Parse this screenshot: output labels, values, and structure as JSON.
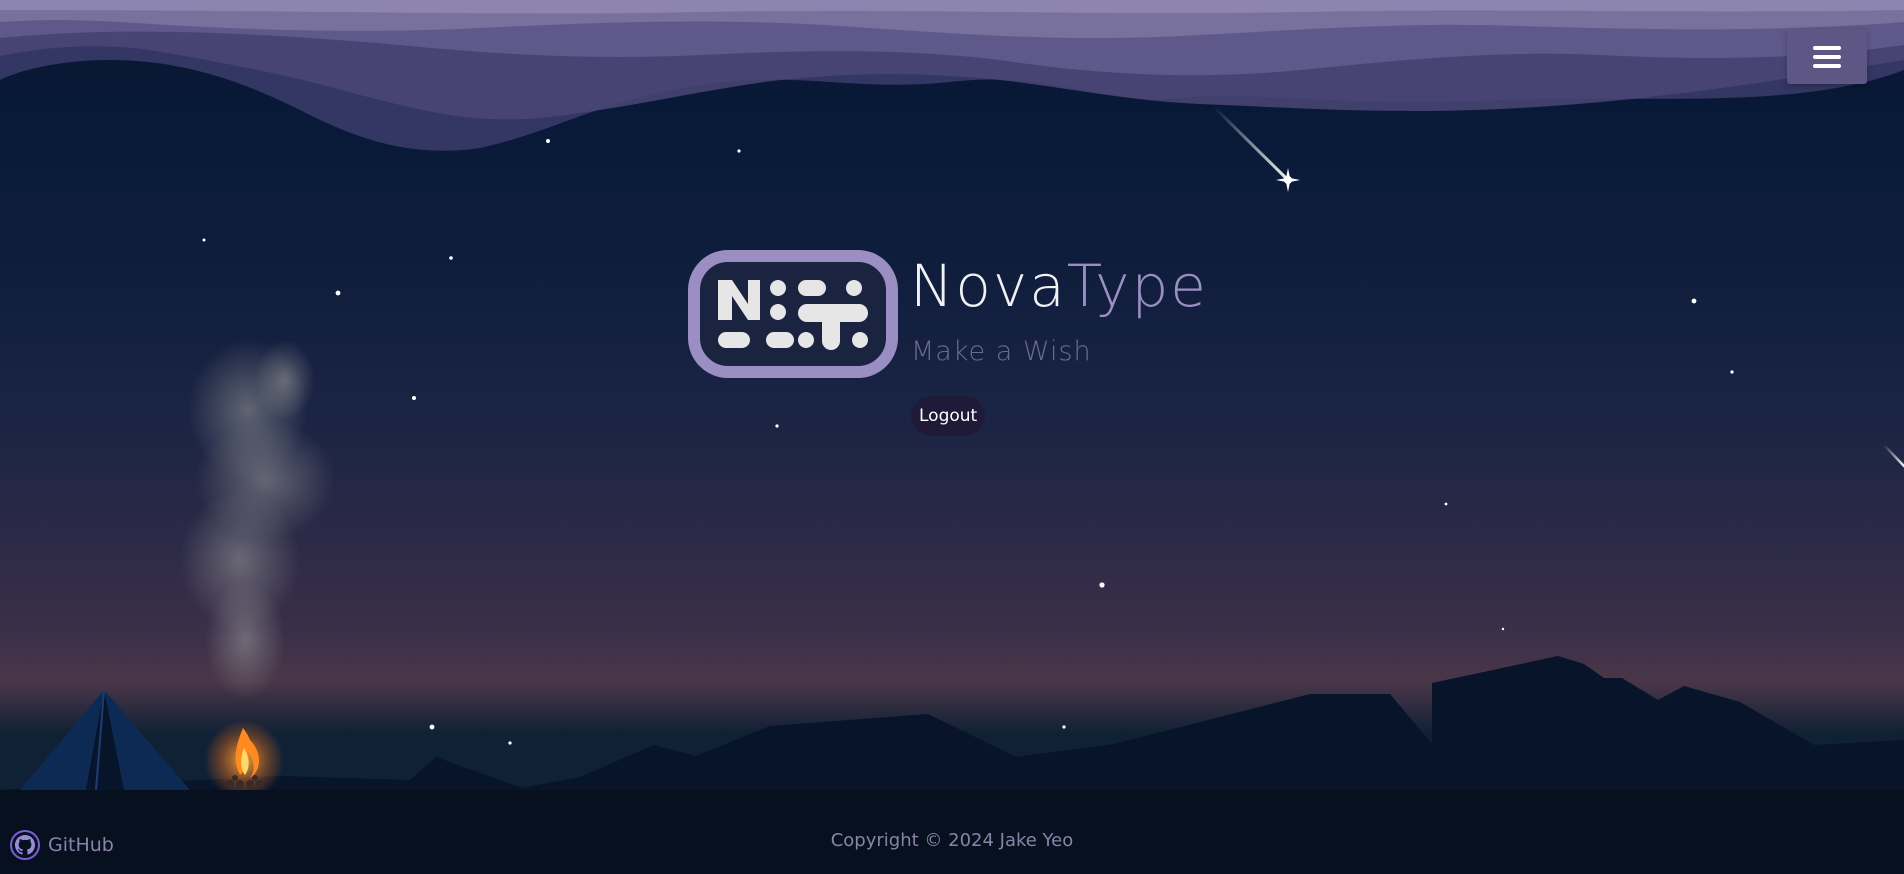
{
  "header": {
    "menu_icon": "hamburger-icon"
  },
  "brand": {
    "name_part1": "Nova",
    "name_part2": "Type",
    "tagline": "Make a Wish",
    "logo_text": "N:T:"
  },
  "auth": {
    "logout_label": "Logout"
  },
  "footer": {
    "github_label": "GitHub",
    "github_icon": "github-icon",
    "copyright": "Copyright © 2024 Jake Yeo"
  },
  "colors": {
    "accent": "#9a8ec2",
    "menu_bg": "#5e5684",
    "logout_bg": "#1f1a38",
    "footer_text": "#8a83a8"
  }
}
